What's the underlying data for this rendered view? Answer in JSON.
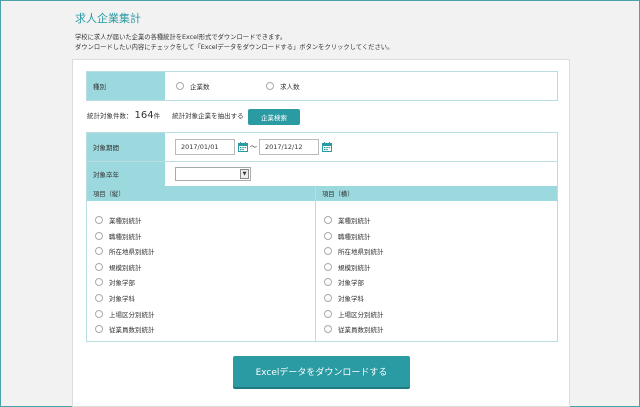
{
  "page": {
    "title": "求人企業集計",
    "desc_line1": "学校に求人が届いた企業の各種統計をExcel形式でダウンロードできます。",
    "desc_line2": "ダウンロードしたい内容にチェックをして「Excelデータをダウンロードする」ボタンをクリックしてください。"
  },
  "type_row": {
    "label": "種別",
    "options": [
      "企業数",
      "求人数"
    ]
  },
  "count": {
    "label": "統計対象件数：",
    "value": "164",
    "unit": "件",
    "extract_label": "統計対象企業を抽出する",
    "search_button": "企業検索"
  },
  "period": {
    "label": "対象期間",
    "from": "2017/01/01",
    "separator": "～",
    "to": "2017/12/12"
  },
  "grad_year": {
    "label": "対象卒年",
    "value": ""
  },
  "columns": {
    "vertical_header": "項目（縦）",
    "horizontal_header": "項目（横）",
    "items": [
      "業種別統計",
      "職種別統計",
      "所在地県別統計",
      "規模別統計",
      "対象学部",
      "対象学科",
      "上場区分別統計",
      "従業員数別統計"
    ]
  },
  "download_button": "Excelデータをダウンロードする",
  "colors": {
    "accent": "#2a9aa3",
    "label_bg": "#9bd9df"
  },
  "icons": {
    "calendar": "calendar-icon",
    "select_arrow": "chevron-down-icon"
  }
}
